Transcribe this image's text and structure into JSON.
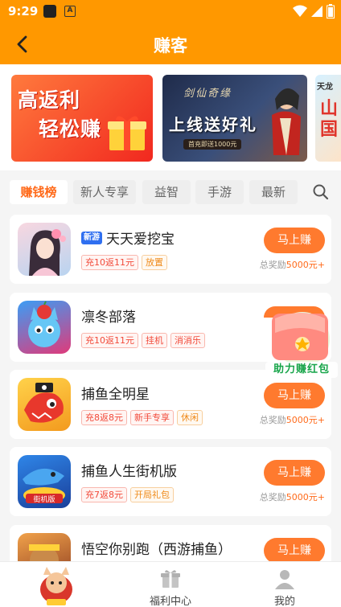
{
  "status_bar": {
    "time": "9:29",
    "a_label": "A"
  },
  "header": {
    "title": "赚客"
  },
  "banners": [
    {
      "line1": "高返利",
      "line2": "轻松赚"
    },
    {
      "logo": "剑仙奇缘",
      "title": "上线送好礼",
      "sub": "首充即送1000元"
    },
    {
      "small": "天龙",
      "big1": "山",
      "big2": "国"
    }
  ],
  "tabs": [
    "赚钱榜",
    "新人专享",
    "益智",
    "手游",
    "最新"
  ],
  "games": [
    {
      "title": "天天爱挖宝",
      "badge": "新游",
      "tags": [
        {
          "text": "充10返11元",
          "style": "red"
        },
        {
          "text": "放置",
          "style": "orange"
        }
      ],
      "button": "马上赚",
      "reward_prefix": "总奖励",
      "reward": "5000元+"
    },
    {
      "title": "凛冬部落",
      "badge": "",
      "tags": [
        {
          "text": "充10返11元",
          "style": "red"
        },
        {
          "text": "挂机",
          "style": "red"
        },
        {
          "text": "消消乐",
          "style": "red"
        }
      ],
      "button": "",
      "reward_prefix": "",
      "reward": ""
    },
    {
      "title": "捕鱼全明星",
      "badge": "",
      "tags": [
        {
          "text": "充8返8元",
          "style": "red"
        },
        {
          "text": "新手专享",
          "style": "red"
        },
        {
          "text": "休闲",
          "style": "orange"
        }
      ],
      "button": "马上赚",
      "reward_prefix": "总奖励",
      "reward": "5000元+"
    },
    {
      "title": "捕鱼人生街机版",
      "badge": "",
      "tags": [
        {
          "text": "充7返8元",
          "style": "red"
        },
        {
          "text": "开局礼包",
          "style": "orange"
        }
      ],
      "button": "马上赚",
      "reward_prefix": "总奖励",
      "reward": "5000元+"
    },
    {
      "title": "悟空你别跑（西游捕鱼）",
      "badge": "",
      "tags": [],
      "button": "马上赚",
      "reward_prefix": "",
      "reward": ""
    }
  ],
  "float_widget": {
    "label": "助力赚红包"
  },
  "bottom_nav": [
    {
      "label": "",
      "icon": "mascot-icon"
    },
    {
      "label": "福利中心",
      "icon": "gift-icon"
    },
    {
      "label": "我的",
      "icon": "user-icon"
    }
  ],
  "colors": {
    "brand": "#ff9800",
    "accent": "#ff7a2e",
    "badge_blue": "#2f6ff0",
    "tag_red": "#f24a3a",
    "tag_orange": "#ef8a1a",
    "float_green": "#18a54a"
  }
}
